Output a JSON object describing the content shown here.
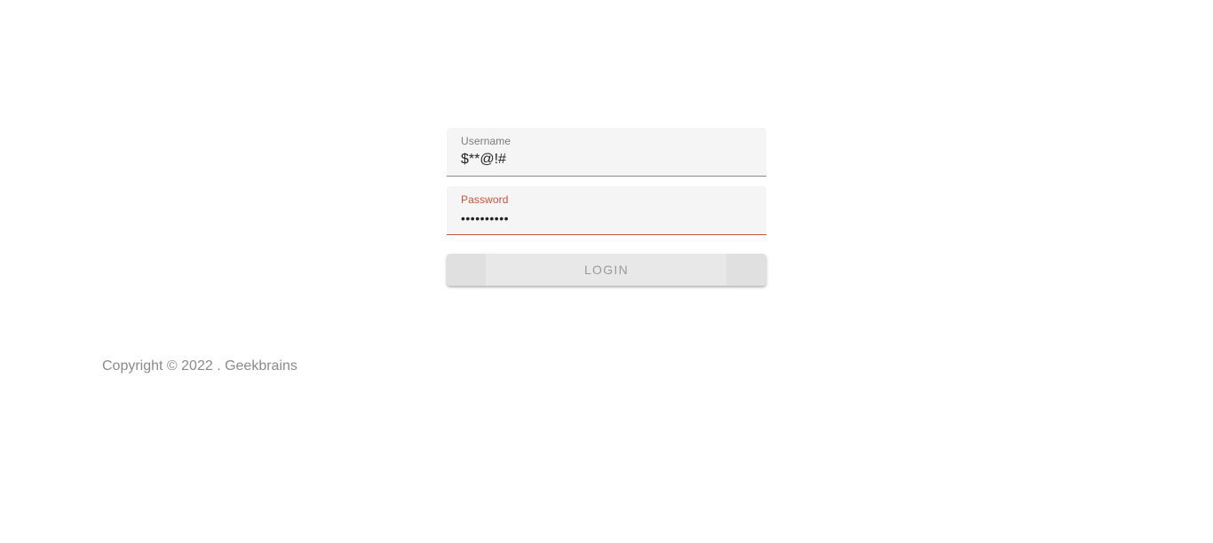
{
  "login_form": {
    "username": {
      "label": "Username",
      "value": "$**@!#"
    },
    "password": {
      "label": "Password",
      "value": "••••••••••"
    },
    "login_button_label": "LOGIN"
  },
  "footer": {
    "copyright_text": "Copyright © 2022 . Geekbrains"
  },
  "colors": {
    "error": "#c9523e",
    "field_background": "#f5f5f5",
    "button_background": "#e8e8e8",
    "muted_text": "#8a8a8a"
  }
}
